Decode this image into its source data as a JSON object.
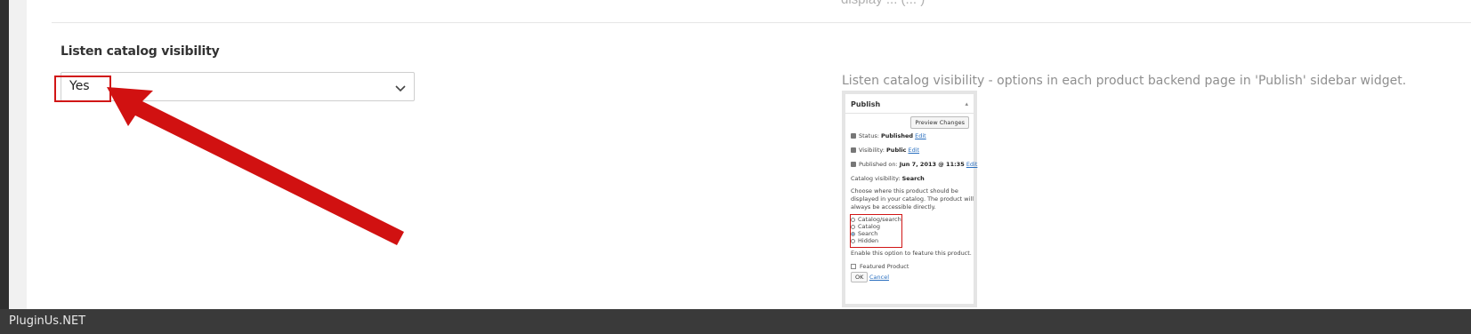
{
  "top_partial_text": "display ... (... )",
  "setting": {
    "label": "Listen catalog visibility",
    "select_value": "Yes"
  },
  "description": "Listen catalog visibility - options in each product backend page in 'Publish' sidebar widget.",
  "publish_widget": {
    "title": "Publish",
    "preview_button": "Preview Changes",
    "status_label": "Status:",
    "status_value": "Published",
    "status_edit": "Edit",
    "visibility_label": "Visibility:",
    "visibility_value": "Public",
    "visibility_edit": "Edit",
    "published_label": "Published on:",
    "published_value": "Jun 7, 2013 @ 11:35",
    "published_edit": "Edit",
    "catalog_visibility_label": "Catalog visibility:",
    "catalog_visibility_value": "Search",
    "help_line1": "Choose where this product should be",
    "help_line2": "displayed in your catalog. The product will",
    "help_line3": "always be accessible directly.",
    "options": [
      "Catalog/search",
      "Catalog",
      "Search",
      "Hidden"
    ],
    "selected_option_index": 2,
    "feature_help": "Enable this option to feature this product.",
    "featured_label": "Featured Product",
    "ok_button": "OK",
    "cancel_link": "Cancel"
  },
  "footer": {
    "brand": "PluginUs.NET"
  },
  "colors": {
    "highlight": "#d11616",
    "footer_bg": "#3a3a3a",
    "link": "#2a6fbf"
  }
}
